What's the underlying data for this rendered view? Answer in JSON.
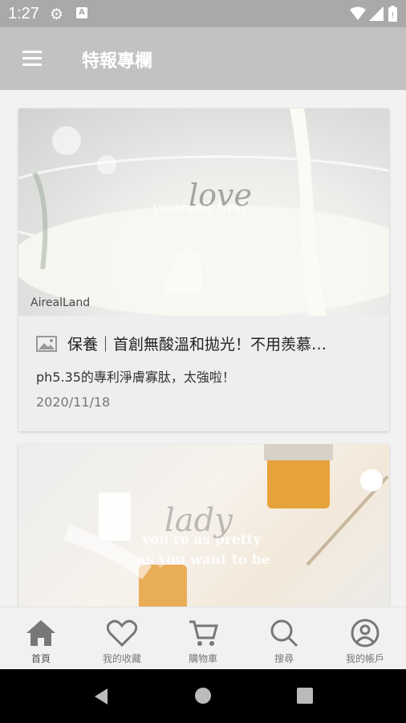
{
  "status_bar": {
    "time": "1:27",
    "icons": [
      "settings-icon",
      "app-notification-icon",
      "wifi-icon",
      "signal-icon",
      "battery-icon"
    ]
  },
  "app_bar": {
    "title": "特報專欄",
    "menu_icon": "hamburger-menu-icon"
  },
  "articles": [
    {
      "image_overlay_text": "yourself first",
      "image_script_text": "love",
      "image_watermark": "AirealLand",
      "title": "保養｜首創無酸溫和拋光！不用羨慕…",
      "subtitle": "ph5.35的專利淨膚寡肽，太強啦！",
      "date": "2020/11/18"
    },
    {
      "image_overlay_line1": "you're as pretty",
      "image_overlay_line2": "as you want to be",
      "image_script_text": "lady"
    }
  ],
  "bottom_nav": [
    {
      "label": "首頁",
      "icon": "home-icon",
      "active": true
    },
    {
      "label": "我的收藏",
      "icon": "heart-icon",
      "active": false
    },
    {
      "label": "購物車",
      "icon": "cart-icon",
      "active": false
    },
    {
      "label": "搜尋",
      "icon": "search-icon",
      "active": false
    },
    {
      "label": "我的帳戶",
      "icon": "account-icon",
      "active": false
    }
  ],
  "colors": {
    "status_bar": "#a9a9a9",
    "app_bar": "#c2c2c2",
    "background": "#f2f2f2",
    "nav_icon": "#777777"
  }
}
